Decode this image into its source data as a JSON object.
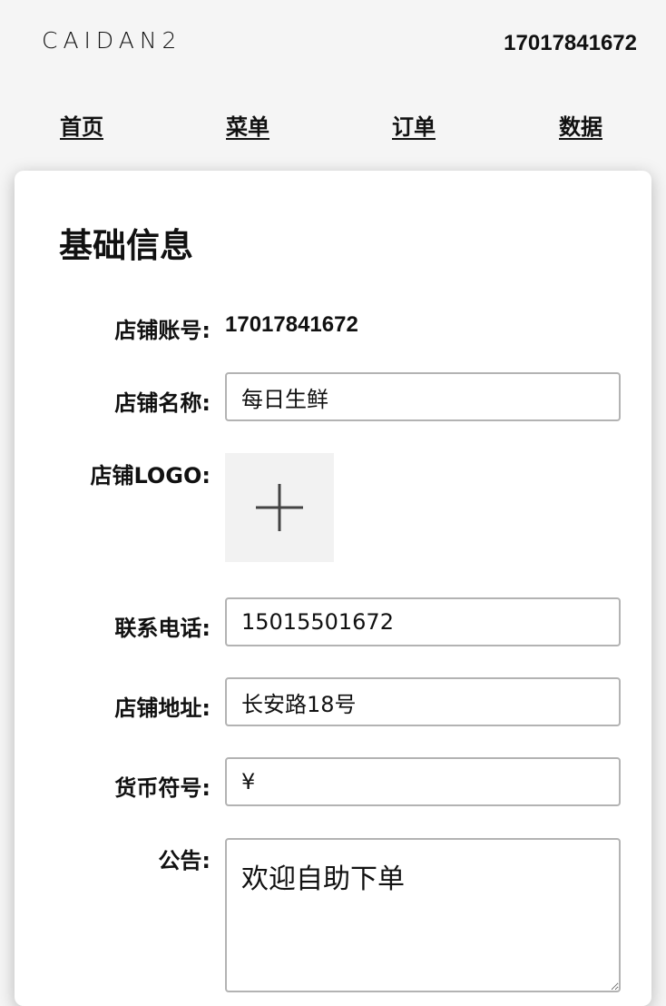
{
  "header": {
    "logo": "CAIDAN2",
    "account": "17017841672"
  },
  "nav": {
    "items": [
      "首页",
      "菜单",
      "订单",
      "数据"
    ]
  },
  "card": {
    "title": "基础信息",
    "fields": {
      "account": {
        "label": "店铺账号:",
        "value": "17017841672"
      },
      "name": {
        "label": "店铺名称:",
        "value": "每日生鲜"
      },
      "logo": {
        "label": "店铺LOGO:",
        "icon": "plus-icon"
      },
      "phone": {
        "label": "联系电话:",
        "value": "15015501672"
      },
      "address": {
        "label": "店铺地址:",
        "value": "长安路18号"
      },
      "currency": {
        "label": "货币符号:",
        "value": "¥"
      },
      "notice": {
        "label": "公告:",
        "value": "欢迎自助下单"
      }
    }
  }
}
